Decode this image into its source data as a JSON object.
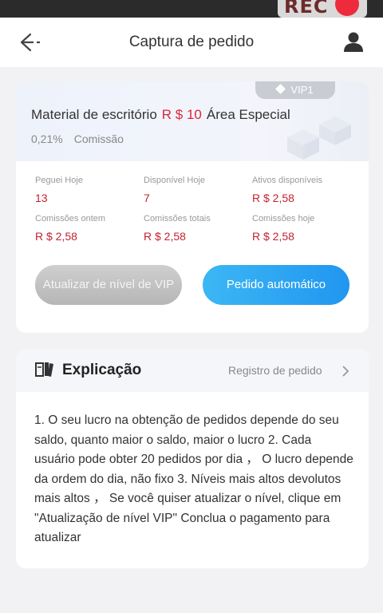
{
  "recording": {
    "label": "REC"
  },
  "header": {
    "title": "Captura de pedido",
    "back_icon": "arrow-left-icon",
    "user_icon": "user-icon"
  },
  "card": {
    "vip_tag": "VIP1",
    "product_name": "Material de escritório",
    "price": "R $ 10",
    "area": "Área Especial",
    "commission_rate": "0,21%",
    "commission_label": "Comissão",
    "stats": [
      {
        "label": "Peguei Hoje",
        "value": "13"
      },
      {
        "label": "Disponível Hoje",
        "value": "7"
      },
      {
        "label": "Ativos disponíveis",
        "value": "R $ 2,58"
      },
      {
        "label": "Comissões ontem",
        "value": "R $ 2,58"
      },
      {
        "label": "Comissões totais",
        "value": "R $ 2,58"
      },
      {
        "label": "Comissões hoje",
        "value": "R $ 2,58"
      }
    ],
    "btn_vip": "Atualizar de nível de VIP",
    "btn_auto": "Pedido automático"
  },
  "explanation": {
    "title": "Explicação",
    "orders_link": "Registro de pedido",
    "text": "1. O seu lucro na obtenção de pedidos depende do seu saldo, quanto maior o saldo, maior o lucro 2. Cada usuário pode obter 20 pedidos por dia ， O lucro depende da ordem do dia, não fixo 3. Níveis mais altos devolutos mais altos ， Se você quiser atualizar o nível, clique em \"Atualização de nível VIP\" Conclua o pagamento para atualizar"
  },
  "colors": {
    "price": "#d9283b",
    "accent_blue": "#2196f0",
    "stat_value": "#c4232f"
  }
}
